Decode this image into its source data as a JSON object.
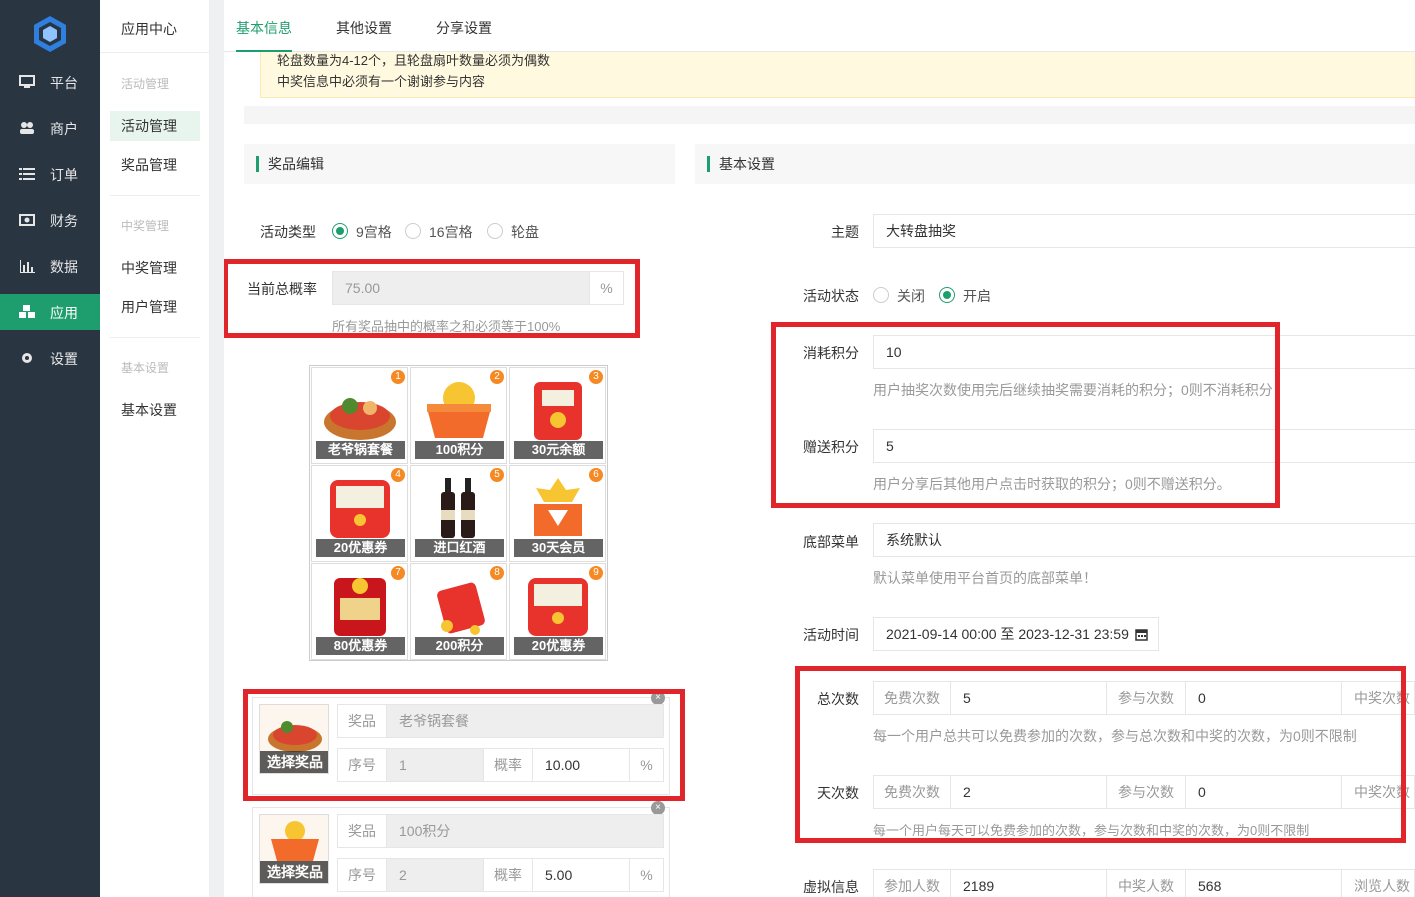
{
  "nav": {
    "items": [
      {
        "label": "平台",
        "icon": "monitor-icon"
      },
      {
        "label": "商户",
        "icon": "users-icon"
      },
      {
        "label": "订单",
        "icon": "list-icon"
      },
      {
        "label": "财务",
        "icon": "money-icon"
      },
      {
        "label": "数据",
        "icon": "bar-chart-icon"
      },
      {
        "label": "应用",
        "icon": "cubes-icon"
      },
      {
        "label": "设置",
        "icon": "gear-icon"
      }
    ]
  },
  "subnav": {
    "title": "应用中心",
    "groups": [
      {
        "header": "活动管理",
        "items": [
          "活动管理",
          "奖品管理"
        ]
      },
      {
        "header": "中奖管理",
        "items": [
          "中奖管理",
          "用户管理"
        ]
      },
      {
        "header": "基本设置",
        "items": [
          "基本设置"
        ]
      }
    ]
  },
  "tabs": [
    "基本信息",
    "其他设置",
    "分享设置"
  ],
  "notice": {
    "line1": "轮盘数量为4-12个，且轮盘扇叶数量必须为偶数",
    "line2": "中奖信息中必须有一个谢谢参与内容"
  },
  "prize_edit": {
    "title": "奖品编辑",
    "type_label": "活动类型",
    "type_options": [
      "9宫格",
      "16宫格",
      "轮盘"
    ],
    "type_selected": "9宫格",
    "prob_label": "当前总概率",
    "prob_value": "75.00",
    "prob_unit": "%",
    "prob_hint": "所有奖品抽中的概率之和必须等于100%",
    "grid": [
      {
        "no": "1",
        "name": "老爷锅套餐"
      },
      {
        "no": "2",
        "name": "100积分"
      },
      {
        "no": "3",
        "name": "30元余额"
      },
      {
        "no": "4",
        "name": "20优惠券"
      },
      {
        "no": "5",
        "name": "进口红酒"
      },
      {
        "no": "6",
        "name": "30天会员"
      },
      {
        "no": "7",
        "name": "80优惠券"
      },
      {
        "no": "8",
        "name": "200积分"
      },
      {
        "no": "9",
        "name": "20优惠券"
      }
    ],
    "prizes": [
      {
        "select_label": "选择奖品",
        "prize_label": "奖品",
        "prize_value": "老爷锅套餐",
        "order_label": "序号",
        "order_value": "1",
        "prob_label": "概率",
        "prob_value": "10.00",
        "unit": "%"
      },
      {
        "select_label": "选择奖品",
        "prize_label": "奖品",
        "prize_value": "100积分",
        "order_label": "序号",
        "order_value": "2",
        "prob_label": "概率",
        "prob_value": "5.00",
        "unit": "%"
      }
    ]
  },
  "basic": {
    "title": "基本设置",
    "theme_label": "主题",
    "theme_value": "大转盘抽奖",
    "status_label": "活动状态",
    "status_options": [
      "关闭",
      "开启"
    ],
    "status_selected": "开启",
    "cost_label": "消耗积分",
    "cost_value": "10",
    "cost_hint": "用户抽奖次数使用完后继续抽奖需要消耗的积分；0则不消耗积分",
    "gift_label": "赠送积分",
    "gift_value": "5",
    "gift_hint": "用户分享后其他用户点击时获取的积分；0则不赠送积分。",
    "menu_label": "底部菜单",
    "menu_value": "系统默认",
    "menu_hint": "默认菜单使用平台首页的底部菜单！",
    "time_label": "活动时间",
    "time_value": "2021-09-14 00:00 至 2023-12-31 23:59",
    "total_label": "总次数",
    "total_free_label": "免费次数",
    "total_free_value": "5",
    "total_join_label": "参与次数",
    "total_join_value": "0",
    "total_win_label": "中奖次数",
    "total_hint": "每一个用户总共可以免费参加的次数，参与总次数和中奖的次数，为0则不限制",
    "day_label": "天次数",
    "day_free_label": "免费次数",
    "day_free_value": "2",
    "day_join_label": "参与次数",
    "day_join_value": "0",
    "day_win_label": "中奖次数",
    "day_hint": "每一个用户每天可以免费参加的次数，参与次数和中奖的次数，为0则不限制",
    "virtual_label": "虚拟信息",
    "virtual_join_label": "参加人数",
    "virtual_join_value": "2189",
    "virtual_win_label": "中奖人数",
    "virtual_win_value": "568",
    "virtual_view_label": "浏览人数"
  }
}
